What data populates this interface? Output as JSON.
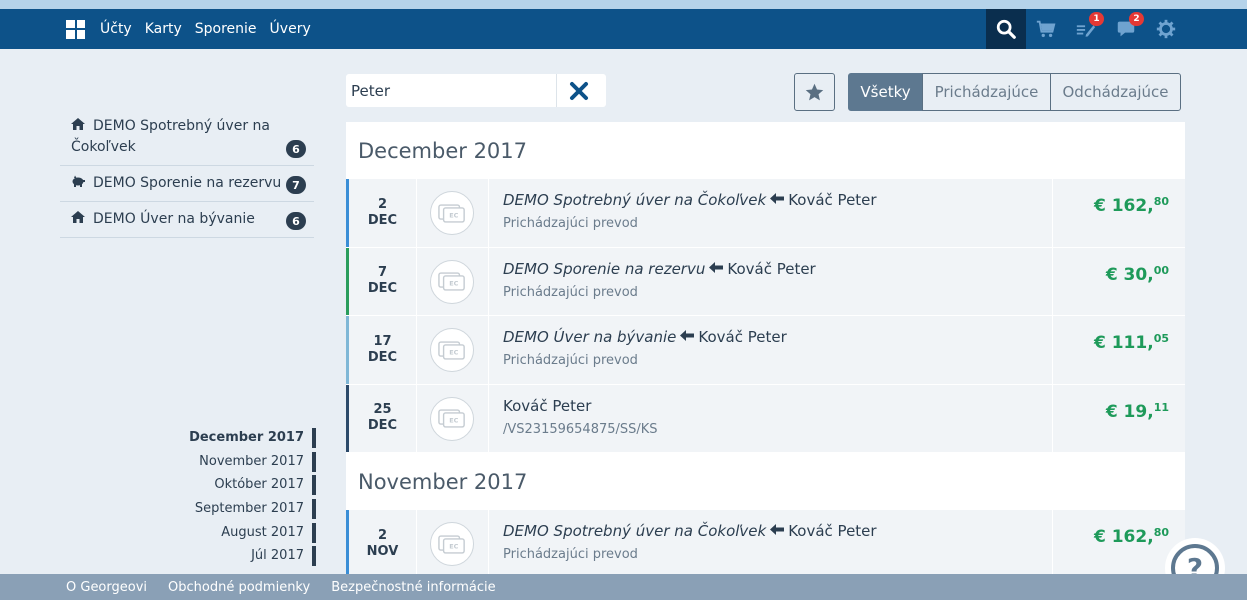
{
  "nav": {
    "links": [
      "Účty",
      "Karty",
      "Sporenie",
      "Úvery"
    ],
    "badges": {
      "tasks": "1",
      "messages": "2"
    }
  },
  "sidebar": {
    "accounts": [
      {
        "name": "DEMO Spotrebný úver na Čokoľvek",
        "count": "6",
        "icon": "home-icon"
      },
      {
        "name": "DEMO Sporenie na rezervu",
        "count": "7",
        "icon": "piggy-bank-icon"
      },
      {
        "name": "DEMO Úver na bývanie",
        "count": "6",
        "icon": "home-icon"
      }
    ],
    "months": [
      "December 2017",
      "November 2017",
      "Október 2017",
      "September 2017",
      "August 2017",
      "Júl 2017"
    ]
  },
  "search": {
    "value": "Peter"
  },
  "filters": [
    "Všetky",
    "Prichádzajúce",
    "Odchádzajúce"
  ],
  "groups": [
    {
      "month": "December 2017",
      "transactions": [
        {
          "day": "2",
          "mon": "DEC",
          "account": "DEMO Spotrebný úver na Čokoľvek",
          "party": "Kováč Peter",
          "sub": "Prichádzajúci prevod",
          "amount_main": "€ 162,",
          "amount_cents": "80",
          "accent": "#3a8ed6"
        },
        {
          "day": "7",
          "mon": "DEC",
          "account": "DEMO Sporenie na rezervu",
          "party": "Kováč Peter",
          "sub": "Prichádzajúci prevod",
          "amount_main": "€ 30,",
          "amount_cents": "00",
          "accent": "#2a9d5c"
        },
        {
          "day": "17",
          "mon": "DEC",
          "account": "DEMO Úver na bývanie",
          "party": "Kováč Peter",
          "sub": "Prichádzajúci prevod",
          "amount_main": "€ 111,",
          "amount_cents": "05",
          "accent": "#7fb7d6"
        },
        {
          "day": "25",
          "mon": "DEC",
          "account": "",
          "party": "Kováč Peter",
          "sub": "/VS23159654875/SS/KS",
          "amount_main": "€ 19,",
          "amount_cents": "11",
          "accent": "#2c4a6a"
        }
      ]
    },
    {
      "month": "November 2017",
      "transactions": [
        {
          "day": "2",
          "mon": "NOV",
          "account": "DEMO Spotrebný úver na Čokoľvek",
          "party": "Kováč Peter",
          "sub": "Prichádzajúci prevod",
          "amount_main": "€ 162,",
          "amount_cents": "80",
          "accent": "#3a8ed6"
        }
      ]
    }
  ],
  "footer": [
    "O Georgeovi",
    "Obchodné podmienky",
    "Bezpečnostné informácie"
  ],
  "colors": {
    "navbar": "#0d5289",
    "amount": "#1e9a5a",
    "footer": "#8aa0b6"
  }
}
